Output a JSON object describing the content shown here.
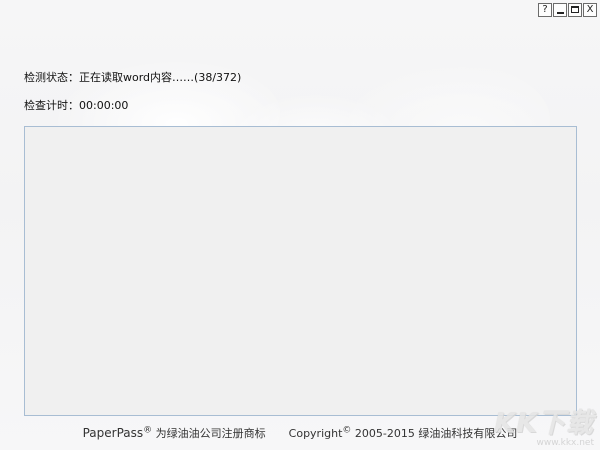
{
  "window": {
    "help_label": "?",
    "close_label": "X"
  },
  "status": {
    "detect_label": "检测状态：",
    "detect_value": "正在读取word内容……(38/372)",
    "timer_label": "检查计时：",
    "timer_value": "00:00:00"
  },
  "footer": {
    "brand": "PaperPass",
    "registered_mark": "®",
    "trademark_text": "为绿油油公司注册商标",
    "copyright_word": "Copyright",
    "copyright_mark": "©",
    "copyright_text": "2005-2015 绿油油科技有限公司"
  },
  "watermark": {
    "logo_text": "KK下载",
    "url": "www.kkx.net"
  }
}
